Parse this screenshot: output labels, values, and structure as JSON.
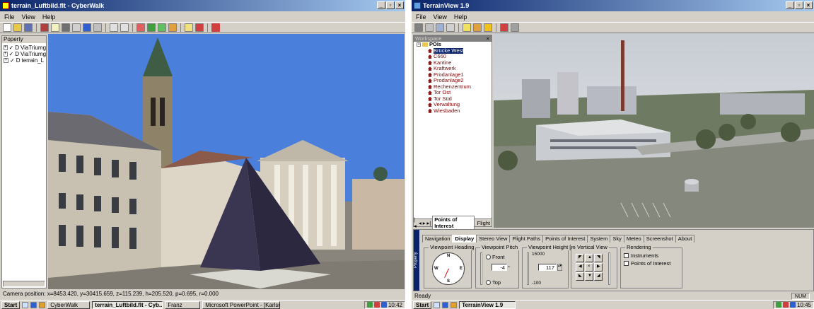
{
  "left_window": {
    "title": "terrain_Luftbild.flt - CyberWalk",
    "controls": [
      "_",
      "▫",
      "×"
    ],
    "menu": [
      "File",
      "View",
      "Help"
    ],
    "tree_header": "Poperty",
    "tree_items": [
      {
        "check": "✓",
        "type": "D",
        "label": "ViaTriumg"
      },
      {
        "check": "✓",
        "type": "D",
        "label": "ViaTriumg"
      },
      {
        "check": "✓",
        "type": "D",
        "label": "terrain_L"
      }
    ],
    "status": "Camera position: x=8453.420, y=30415.659, z=115.239, h=205.520, p=0.695, r=0.000",
    "sky_color": "#4a7fdc"
  },
  "left_taskbar": {
    "start": "Start",
    "buttons": [
      "CyberWalk",
      "terrain_Luftbild.flt - Cyb...",
      "Franz",
      "Microsoft PowerPoint - [Karlsru..."
    ],
    "clock": "10:42"
  },
  "right_window": {
    "title": "TerrainView 1.9",
    "controls": [
      "_",
      "▫",
      "×"
    ],
    "menu": [
      "File",
      "View",
      "Help"
    ],
    "panel_title": "Workspace",
    "poi_root": "POIs",
    "poi_items": [
      "Brücke West",
      "C660",
      "Kantine",
      "Kraftwerk",
      "Prodanlage1",
      "Prodanlage2",
      "Rechenzentrum",
      "Tor Ost",
      "Tor Süd",
      "Verwaltung",
      "Wiesbaden"
    ],
    "poi_selected": 0,
    "bottom_tabs": [
      "Points of Interest",
      "Flight"
    ],
    "side_label": "Property",
    "prop_tabs": [
      "Navigation",
      "Display",
      "Stereo View",
      "Flight Paths",
      "Points of Interest",
      "System",
      "Sky",
      "Meteo",
      "Screenshot",
      "About"
    ],
    "prop_tab_active": 1,
    "heading_group": "Viewpoint Heading",
    "compass": {
      "n": "N",
      "s": "S",
      "w": "W",
      "e": "E"
    },
    "pitch_group": "Viewpoint Pitch",
    "pitch_front": "Front",
    "pitch_top": "Top",
    "pitch_value": "-4",
    "pitch_unit": "°",
    "height_group": "Viewpoint Height [m]",
    "height_max": "15000",
    "height_min": "-100",
    "height_value": "117",
    "vertical_group": "Vertical View",
    "nav_center": "×",
    "rendering_group": "Rendering",
    "rendering_options": [
      "Instruments",
      "Points of Interest"
    ],
    "status": "Ready",
    "status_right": "NUM"
  },
  "right_taskbar": {
    "start": "Start",
    "buttons": [
      "TerrainView 1.9"
    ],
    "clock": "10:45"
  }
}
